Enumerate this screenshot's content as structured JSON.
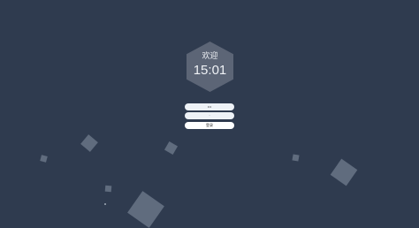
{
  "login": {
    "welcome": "欢迎",
    "time": "15:01",
    "username_value": "•••",
    "password_value": "·",
    "submit_label": "登录"
  },
  "colors": {
    "background": "#2f3b4f",
    "hexagon": "#5c6576",
    "input": "#eef2f7"
  }
}
